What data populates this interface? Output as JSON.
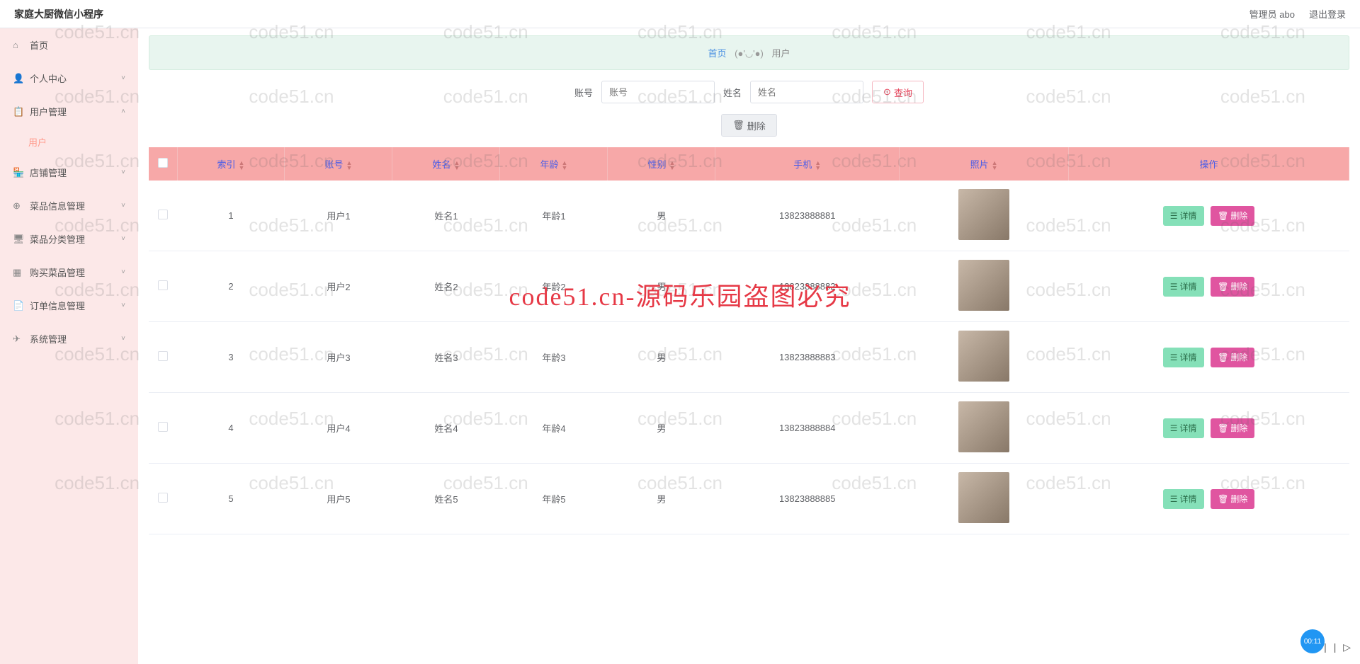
{
  "header": {
    "title": "家庭大厨微信小程序",
    "admin_label": "管理员 abo",
    "logout": "退出登录"
  },
  "sidebar": {
    "items": [
      {
        "icon": "⌂",
        "label": "首页",
        "expandable": false
      },
      {
        "icon": "👤",
        "label": "个人中心",
        "expandable": true
      },
      {
        "icon": "📋",
        "label": "用户管理",
        "expandable": true,
        "expanded": true,
        "sub": "用户"
      },
      {
        "icon": "🏪",
        "label": "店铺管理",
        "expandable": true
      },
      {
        "icon": "⊕",
        "label": "菜品信息管理",
        "expandable": true
      },
      {
        "icon": "🖥",
        "label": "菜品分类管理",
        "expandable": true
      },
      {
        "icon": "▦",
        "label": "购买菜品管理",
        "expandable": true
      },
      {
        "icon": "📄",
        "label": "订单信息管理",
        "expandable": true
      },
      {
        "icon": "✈",
        "label": "系统管理",
        "expandable": true
      }
    ]
  },
  "breadcrumb": {
    "home": "首页",
    "sep": "(●'◡'●)",
    "current": "用户"
  },
  "search": {
    "account_label": "账号",
    "account_placeholder": "账号",
    "name_label": "姓名",
    "name_placeholder": "姓名",
    "query_btn": "查询"
  },
  "toolbar": {
    "delete_btn": "删除"
  },
  "table": {
    "headers": [
      "索引",
      "账号",
      "姓名",
      "年龄",
      "性别",
      "手机",
      "照片",
      "操作"
    ],
    "rows": [
      {
        "index": "1",
        "account": "用户1",
        "name": "姓名1",
        "age": "年龄1",
        "gender": "男",
        "phone": "13823888881"
      },
      {
        "index": "2",
        "account": "用户2",
        "name": "姓名2",
        "age": "年龄2",
        "gender": "男",
        "phone": "13823888882"
      },
      {
        "index": "3",
        "account": "用户3",
        "name": "姓名3",
        "age": "年龄3",
        "gender": "男",
        "phone": "13823888883"
      },
      {
        "index": "4",
        "account": "用户4",
        "name": "姓名4",
        "age": "年龄4",
        "gender": "男",
        "phone": "13823888884"
      },
      {
        "index": "5",
        "account": "用户5",
        "name": "姓名5",
        "age": "年龄5",
        "gender": "男",
        "phone": "13823888885"
      }
    ],
    "detail_btn": "详情",
    "delete_btn": "删除"
  },
  "watermark": {
    "text": "code51.cn",
    "center": "code51.cn-源码乐园盗图必究"
  },
  "timer": "00:11"
}
